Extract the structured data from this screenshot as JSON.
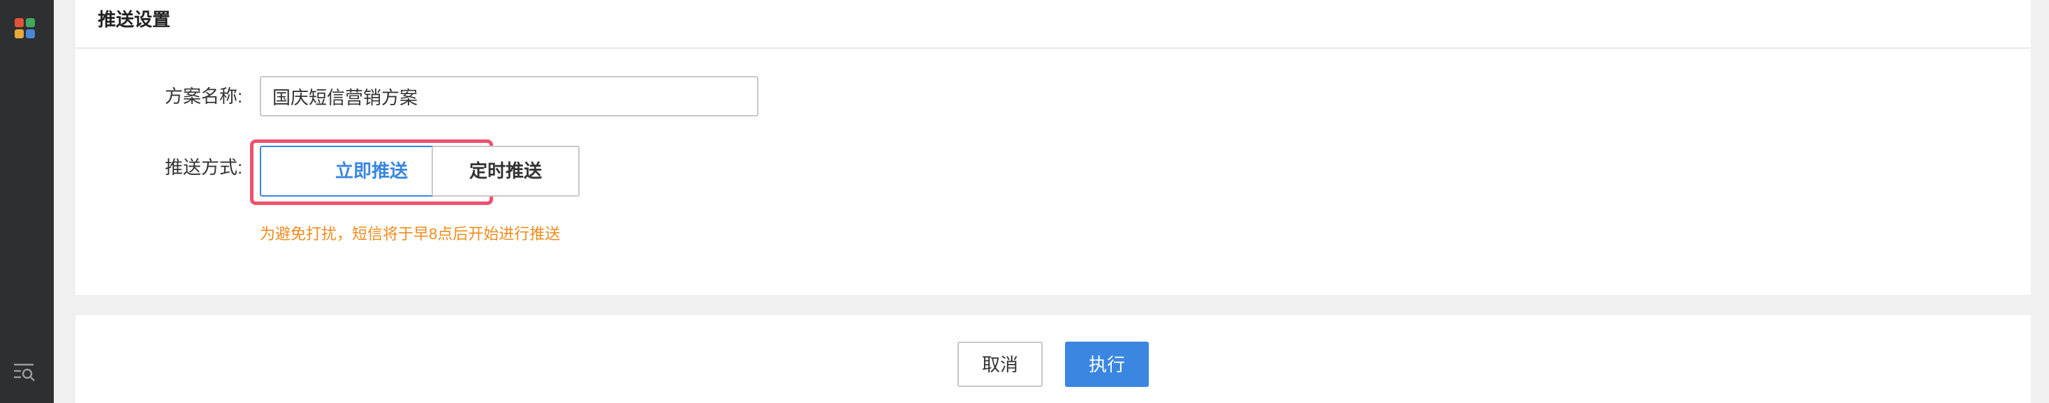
{
  "sidebar": {
    "app_icon": "app-grid-icon",
    "bottom_icon": "search-list-icon",
    "app_icon_colors": [
      "#e0533b",
      "#3fa85c",
      "#e8a93a",
      "#4a86d8"
    ]
  },
  "panel": {
    "title": "推送设置"
  },
  "form": {
    "name_label": "方案名称:",
    "name_value": "国庆短信营销方案",
    "method_label": "推送方式:",
    "options": [
      {
        "label": "立即推送",
        "selected": true
      },
      {
        "label": "定时推送",
        "selected": false
      }
    ],
    "tip": "为避免打扰，短信将于早8点后开始进行推送"
  },
  "actions": {
    "cancel_label": "取消",
    "execute_label": "执行"
  },
  "colors": {
    "accent": "#3b86e0",
    "tip": "#f08c1e",
    "highlight": "#f0506e",
    "sidebar_bg": "#2e2f31"
  }
}
